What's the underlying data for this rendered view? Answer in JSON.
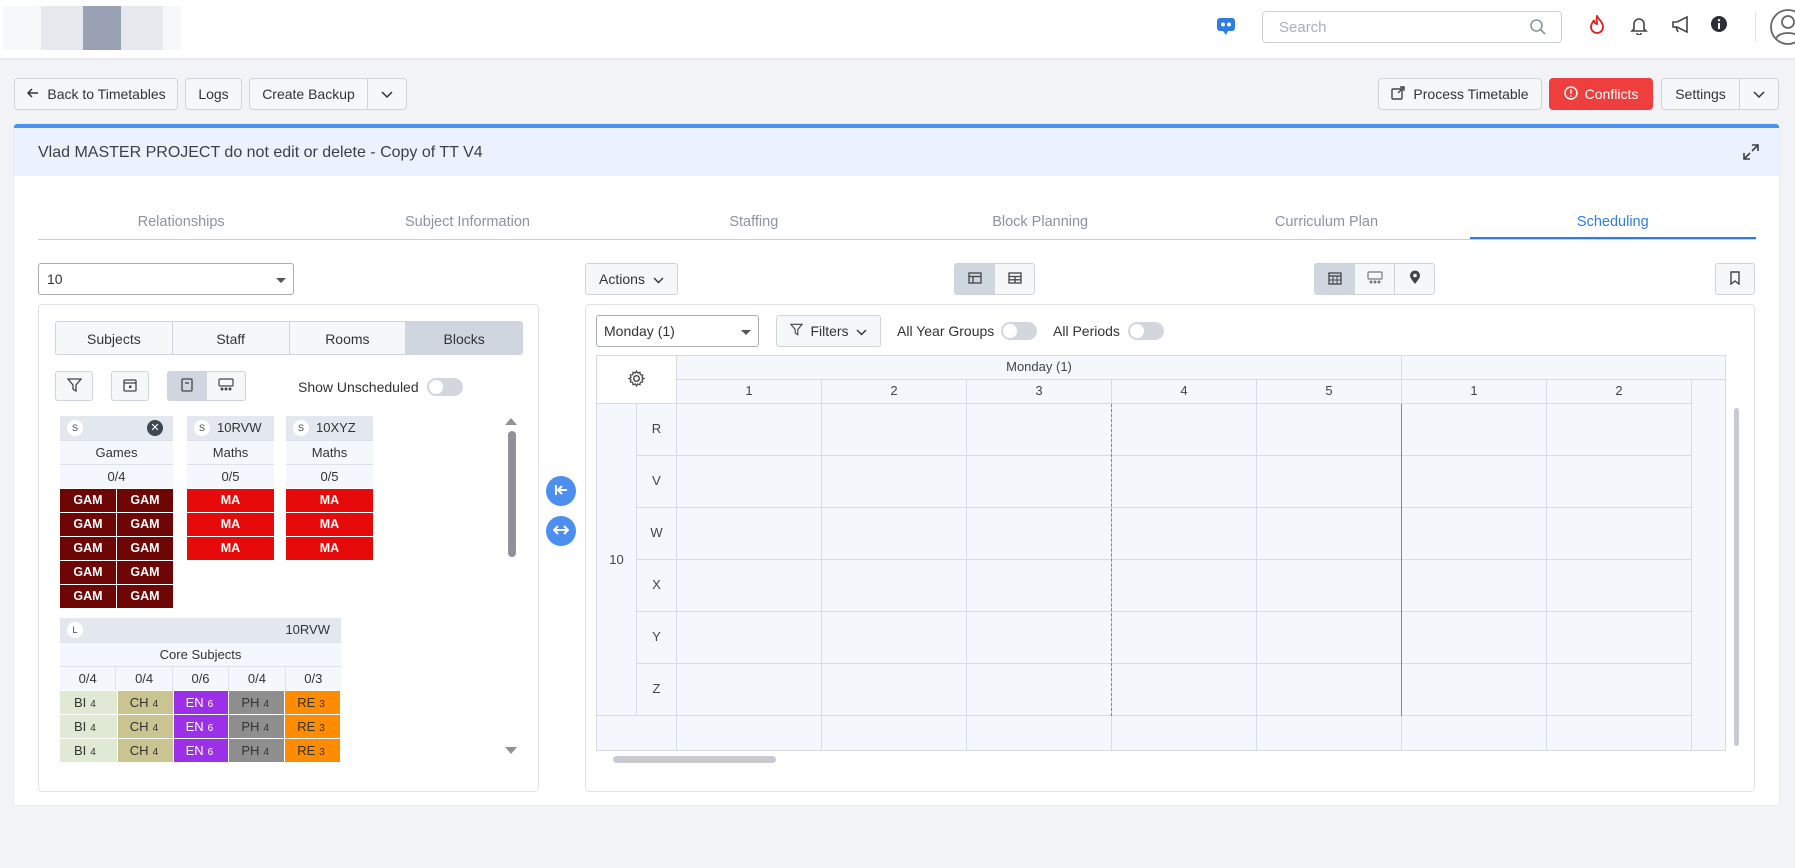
{
  "header": {
    "search_placeholder": "Search"
  },
  "toolbar": {
    "back_label": "Back to Timetables",
    "logs_label": "Logs",
    "backup_label": "Create Backup",
    "process_label": "Process Timetable",
    "conflicts_label": "Conflicts",
    "settings_label": "Settings"
  },
  "project": {
    "title": "Vlad MASTER PROJECT do not edit or delete - Copy of TT V4"
  },
  "tabs": [
    "Relationships",
    "Subject Information",
    "Staffing",
    "Block Planning",
    "Curriculum Plan",
    "Scheduling"
  ],
  "active_tab": "Scheduling",
  "left": {
    "year_value": "10",
    "segments": [
      "Subjects",
      "Staff",
      "Rooms",
      "Blocks"
    ],
    "active_segment": "Blocks",
    "show_unscheduled_label": "Show Unscheduled",
    "blocks": [
      {
        "badge": "S",
        "code": "",
        "name": "Games",
        "count": "0/4",
        "lesson": "GAM",
        "rows": 5,
        "cols": 2,
        "color": "#6e0606"
      },
      {
        "badge": "S",
        "code": "10RVW",
        "name": "Maths",
        "count": "0/5",
        "lesson": "MA",
        "rows": 3,
        "cols": 1,
        "color": "#e60a0a"
      },
      {
        "badge": "S",
        "code": "10XYZ",
        "name": "Maths",
        "count": "0/5",
        "lesson": "MA",
        "rows": 3,
        "cols": 1,
        "color": "#e60a0a"
      }
    ],
    "core": {
      "badge": "L",
      "code": "10RVW",
      "name": "Core Subjects",
      "counts": [
        "0/4",
        "0/4",
        "0/6",
        "0/4",
        "0/3"
      ],
      "subjects": [
        {
          "code": "BI",
          "n": "4",
          "bg": "#dfe9d3",
          "fg": "#333333"
        },
        {
          "code": "CH",
          "n": "4",
          "bg": "#c9c490",
          "fg": "#333333"
        },
        {
          "code": "EN",
          "n": "6",
          "bg": "#9b30e8",
          "fg": "#ffffff"
        },
        {
          "code": "PH",
          "n": "4",
          "bg": "#8e8e8e",
          "fg": "#333333"
        },
        {
          "code": "RE",
          "n": "3",
          "bg": "#ff8c00",
          "fg": "#333333"
        }
      ]
    }
  },
  "right": {
    "actions_label": "Actions",
    "day_value": "Monday (1)",
    "filters_label": "Filters",
    "all_year_groups_label": "All Year Groups",
    "all_periods_label": "All Periods",
    "grid": {
      "day_header": "Monday (1)",
      "periods": [
        "1",
        "2",
        "3",
        "4",
        "5",
        "1",
        "2"
      ],
      "year": "10",
      "rows": [
        "R",
        "V",
        "W",
        "X",
        "Y",
        "Z"
      ]
    }
  }
}
